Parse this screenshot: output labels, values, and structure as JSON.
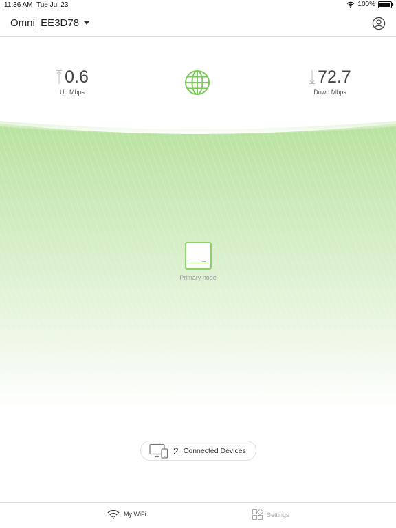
{
  "status_bar": {
    "time": "11:36 AM",
    "date": "Tue Jul 23",
    "battery": "100%",
    "icons": [
      "wifi-icon",
      "battery-icon"
    ]
  },
  "header": {
    "network_name": "Omni_EE3D78",
    "icons": [
      "chevron-down-icon",
      "account-icon"
    ]
  },
  "speed": {
    "up_value": "0.6",
    "up_label": "Up Mbps",
    "down_value": "72.7",
    "down_label": "Down Mbps"
  },
  "internet": {
    "icon": "globe-icon"
  },
  "node": {
    "label": "Primary node",
    "icon": "router-icon"
  },
  "devices": {
    "count": "2",
    "label": "Connected Devices",
    "icon": "devices-icon"
  },
  "tab_bar": {
    "tabs": [
      {
        "label": "My WiFi",
        "icon": "wifi-icon",
        "active": true
      },
      {
        "label": "Settings",
        "icon": "settings-grid-icon",
        "active": false
      }
    ]
  },
  "colors": {
    "accent_green": "#8ed16e",
    "wave_green": "#b8e2a0",
    "inactive_tab": "#aaaaaa"
  }
}
